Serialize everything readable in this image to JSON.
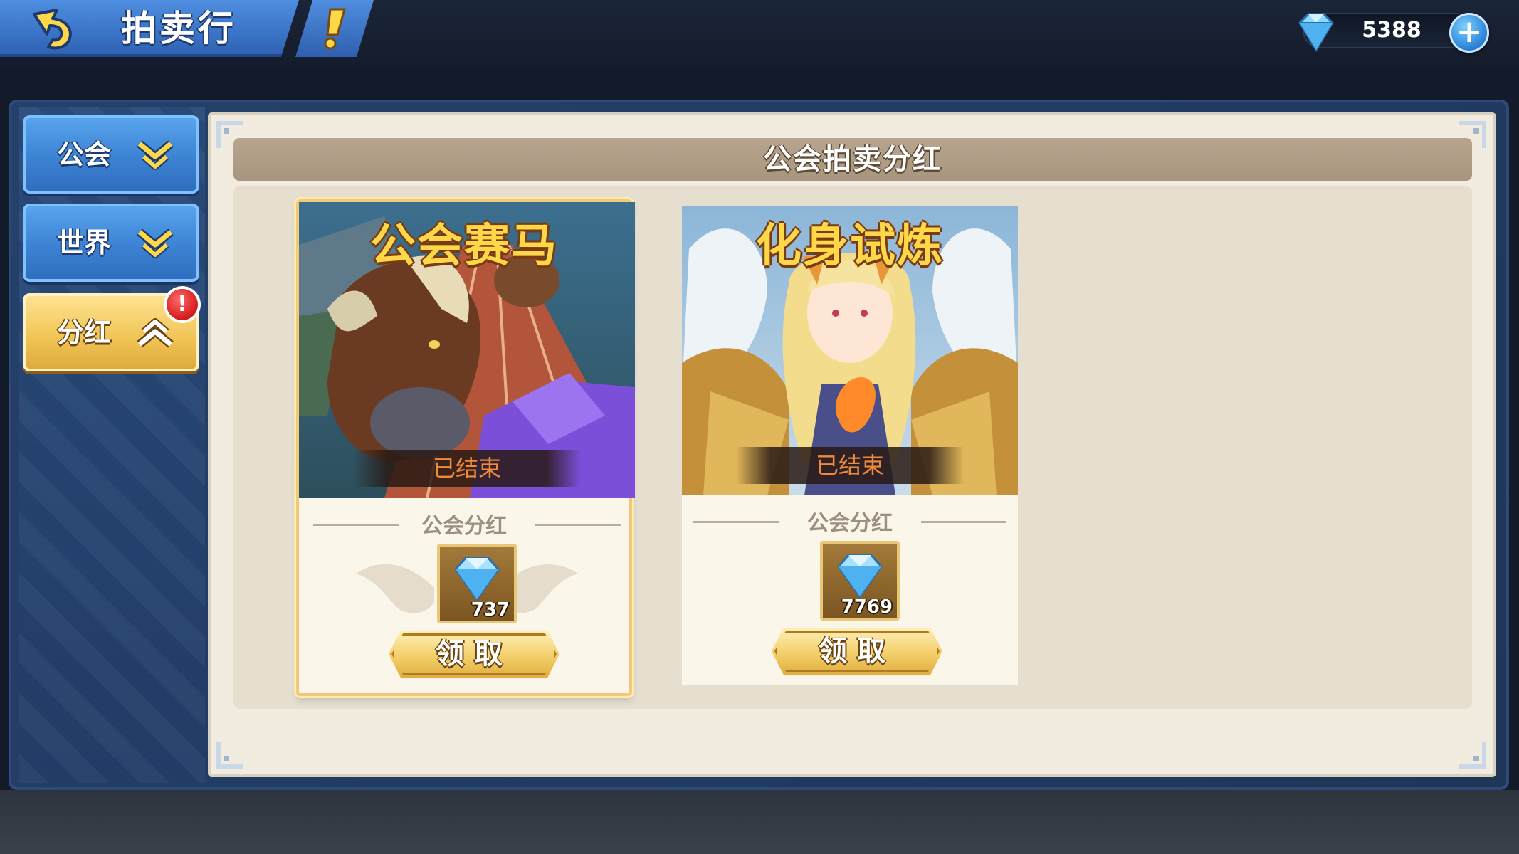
{
  "header": {
    "title": "拍卖行",
    "gem_count": "5388",
    "add_symbol": "+"
  },
  "sidebar": {
    "items": [
      {
        "label": "公会",
        "state": "collapsed"
      },
      {
        "label": "世界",
        "state": "collapsed"
      },
      {
        "label": "分红",
        "state": "expanded",
        "selected": true,
        "alert": "!"
      }
    ]
  },
  "panel": {
    "title": "公会拍卖分红"
  },
  "cards": [
    {
      "title": "公会赛马",
      "status": "已结束",
      "dividend_label": "公会分红",
      "reward_icon": "diamond-icon",
      "reward_amount": "737",
      "button_label": "领取",
      "selected": true
    },
    {
      "title": "化身试炼",
      "status": "已结束",
      "dividend_label": "公会分红",
      "reward_icon": "diamond-icon",
      "reward_amount": "7769",
      "button_label": "领取",
      "selected": false
    }
  ],
  "colors": {
    "tab_blue": "#3c82d3",
    "tab_gold": "#f1c657",
    "panel_bg": "#f1ecdf",
    "header_bar": "#a8957d",
    "status_text": "#f08a3c",
    "title_gold": "#ffd84a"
  }
}
